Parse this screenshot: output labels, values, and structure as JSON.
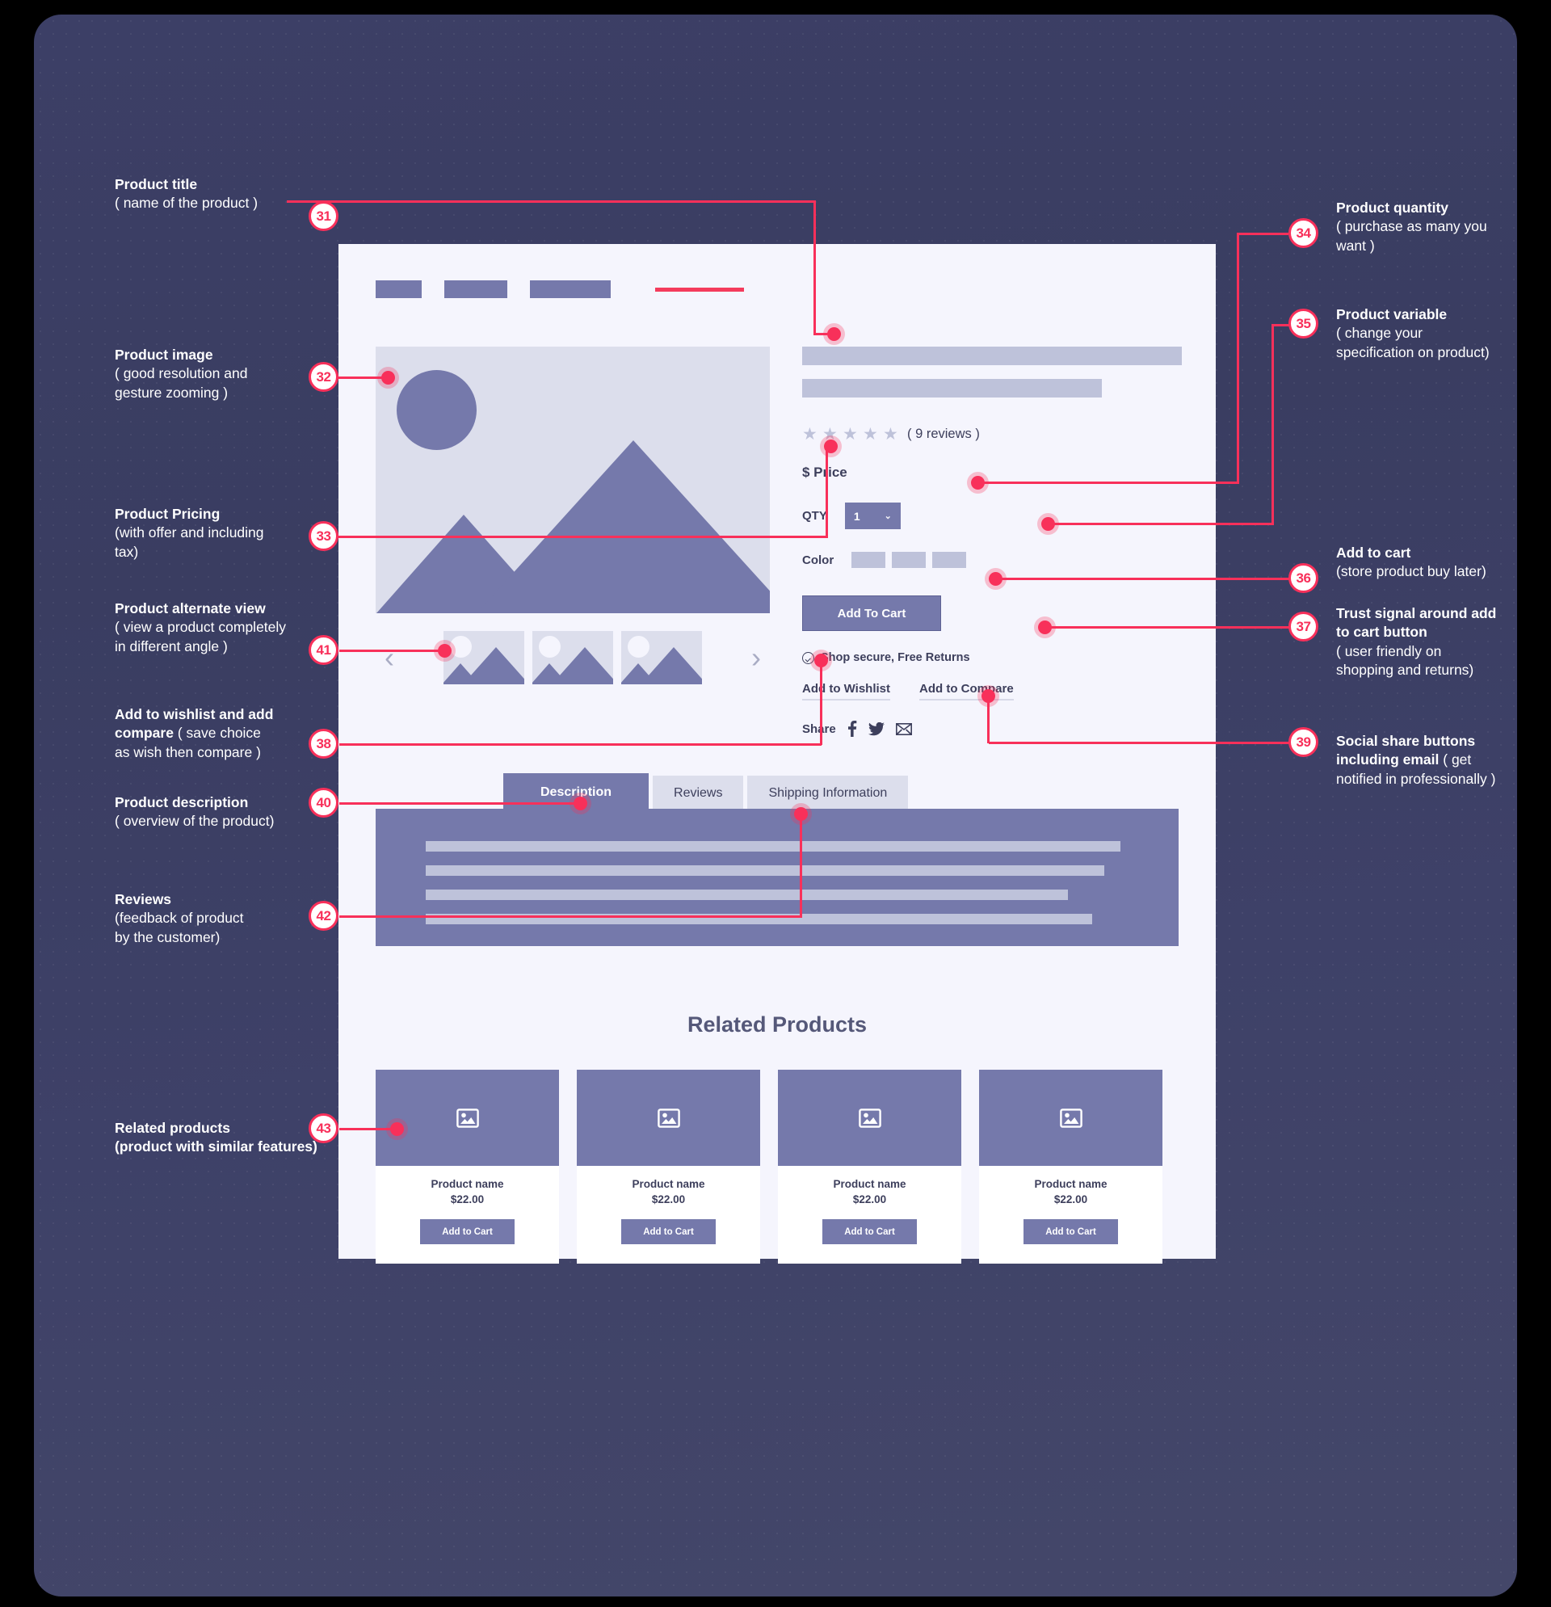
{
  "annotations": [
    {
      "num": "31",
      "title": "Product title",
      "desc": "( name of the product )"
    },
    {
      "num": "32",
      "title": "Product image",
      "desc": "( good resolution and gesture zooming )"
    },
    {
      "num": "33",
      "title": "Product Pricing",
      "desc": "(with offer and including tax)"
    },
    {
      "num": "41",
      "title": "Product alternate view",
      "desc": "( view a product completely in different angle )"
    },
    {
      "num": "38",
      "title": "Add to wishlist and add compare",
      "desc": "( save choice as wish then compare )"
    },
    {
      "num": "40",
      "title": "Product description",
      "desc": "( overview of the product)"
    },
    {
      "num": "42",
      "title": "Reviews",
      "desc": "(feedback of product by the customer)"
    },
    {
      "num": "43",
      "title": "Related products",
      "desc": "(product with similar features)"
    },
    {
      "num": "34",
      "title": "Product quantity",
      "desc": "( purchase as many you want )"
    },
    {
      "num": "35",
      "title": "Product variable",
      "desc": "( change your specification on product)"
    },
    {
      "num": "36",
      "title": "Add to cart",
      "desc": "(store product buy later)"
    },
    {
      "num": "37",
      "title": "Trust signal around add to cart button",
      "desc": "( user friendly on shopping and returns)"
    },
    {
      "num": "39",
      "title": "Social share buttons including email",
      "desc": "( get notified in professionally )"
    }
  ],
  "left_notes": {
    "n31": {
      "title": "Product title",
      "desc": "( name of the product )"
    },
    "n32": {
      "title": "Product image",
      "desc": "( good resolution and\ngesture zooming )"
    },
    "n33": {
      "title": "Product Pricing",
      "desc": "(with offer and including\ntax)"
    },
    "n41": {
      "title": "Product alternate view",
      "desc": "( view a product completely\nin different angle )"
    },
    "n38": {
      "title": "Add to wishlist and add",
      "title2": "compare",
      "desc": "( save choice\nas wish then compare )"
    },
    "n40": {
      "title": "Product description",
      "desc": "( overview of the product)"
    },
    "n42": {
      "title": "Reviews",
      "desc": "(feedback of product\nby the customer)"
    },
    "n43": {
      "title": "Related products",
      "desc": "(product with similar features)"
    }
  },
  "right_notes": {
    "n34": {
      "title": "Product quantity",
      "desc": "( purchase as many you\nwant )"
    },
    "n35": {
      "title": "Product variable",
      "desc": "( change your\nspecification on product)"
    },
    "n36": {
      "title": "Add to cart",
      "desc": "(store product buy later)"
    },
    "n37": {
      "title": "Trust signal around add",
      "title2": "to cart button",
      "desc": "( user friendly on\nshopping and returns)"
    },
    "n39": {
      "title": "Social share buttons",
      "title2": "including email",
      "desc": "( get\nnotified in professionally )"
    }
  },
  "badges": {
    "b31": "31",
    "b32": "32",
    "b33": "33",
    "b41": "41",
    "b38": "38",
    "b40": "40",
    "b42": "42",
    "b43": "43",
    "b34": "34",
    "b35": "35",
    "b36": "36",
    "b37": "37",
    "b39": "39"
  },
  "mock": {
    "nav": {
      "item1": "",
      "item2": "",
      "item3": "",
      "accent": ""
    },
    "reviews_count": "( 9 reviews )",
    "price_label": "$ Price",
    "qty_label": "QTY",
    "qty_value": "1",
    "qty_caret": "⌄",
    "color_label": "Color",
    "add_to_cart": "Add To Cart",
    "trust_text": "Shop secure, Free Returns",
    "wishlist_link": "Add to Wishlist",
    "compare_link": "Add to Compare",
    "share_label": "Share",
    "share_icons": [
      "facebook-icon",
      "twitter-icon",
      "email-icon"
    ],
    "prev_arrow": "‹",
    "next_arrow": "›",
    "star_glyph": "★",
    "tabs": [
      {
        "label": "Description",
        "active": true
      },
      {
        "label": "Reviews",
        "active": false
      },
      {
        "label": "Shipping Information",
        "active": false
      }
    ],
    "related_title": "Related Products",
    "related_products": [
      {
        "name": "Product name",
        "price": "$22.00",
        "button": "Add to Cart"
      },
      {
        "name": "Product name",
        "price": "$22.00",
        "button": "Add to Cart"
      },
      {
        "name": "Product name",
        "price": "$22.00",
        "button": "Add to Cart"
      },
      {
        "name": "Product name",
        "price": "$22.00",
        "button": "Add to Cart"
      }
    ]
  },
  "colors": {
    "accent": "#f8305a",
    "canvas_bg": "#3e4168",
    "mock_bg": "#f5f5fd",
    "wire_mid": "#7579ab",
    "wire_light": "#dcdeec",
    "wire_ph": "#bec2da",
    "text_dark": "#3d3f5c"
  }
}
